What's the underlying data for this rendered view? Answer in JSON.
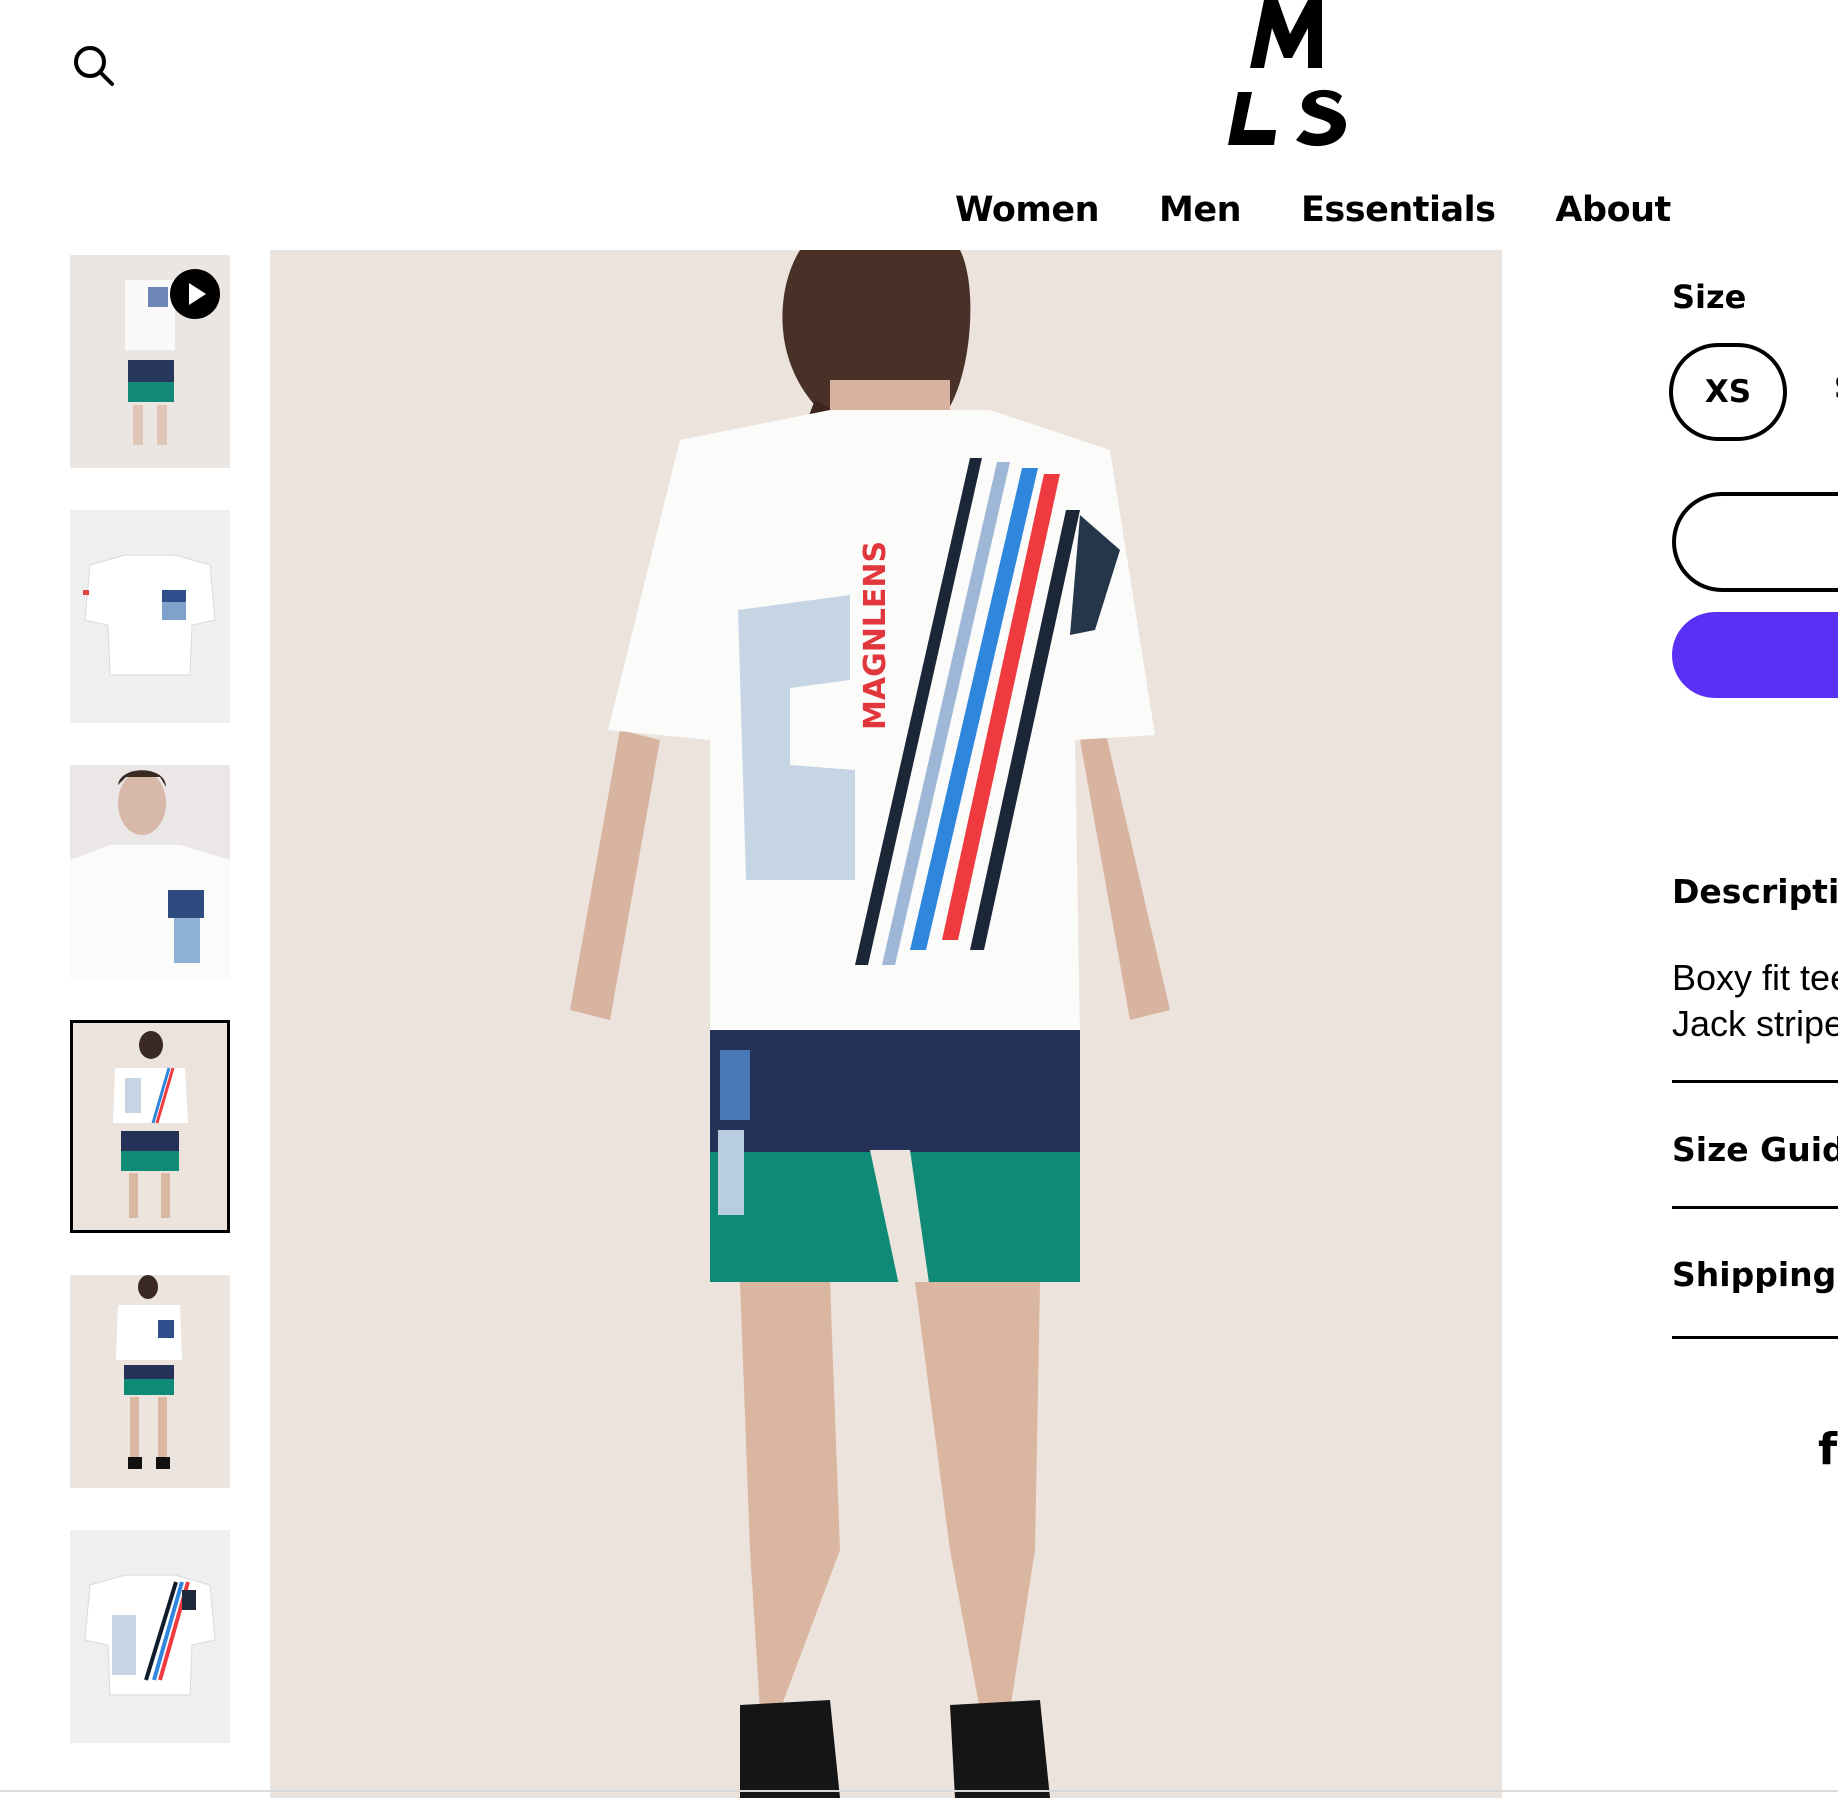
{
  "header": {
    "logo_alt": "MLS",
    "nav": [
      "Women",
      "Men",
      "Essentials",
      "About"
    ]
  },
  "product": {
    "size_label": "Size",
    "sizes_visible": [
      "XS",
      "S"
    ],
    "description_heading": "Descriptio",
    "description_lines": [
      "Boxy fit tee",
      "Jack stripe"
    ],
    "accordions": [
      "Size Guide",
      "Shipping +"
    ],
    "social_icon": "f"
  },
  "media": {
    "shirt_print": "MAGNLENS",
    "thumbnail_count": 6,
    "active_thumbnail": 4,
    "first_thumbnail_has_video": true
  },
  "colors": {
    "buy_button": "#5a31f4",
    "image_background": "#ece3dd",
    "shorts_navy": "#233256",
    "shorts_teal": "#0f8a76",
    "stripe_red": "#ef3b3f",
    "stripe_blue": "#2f86dd"
  }
}
